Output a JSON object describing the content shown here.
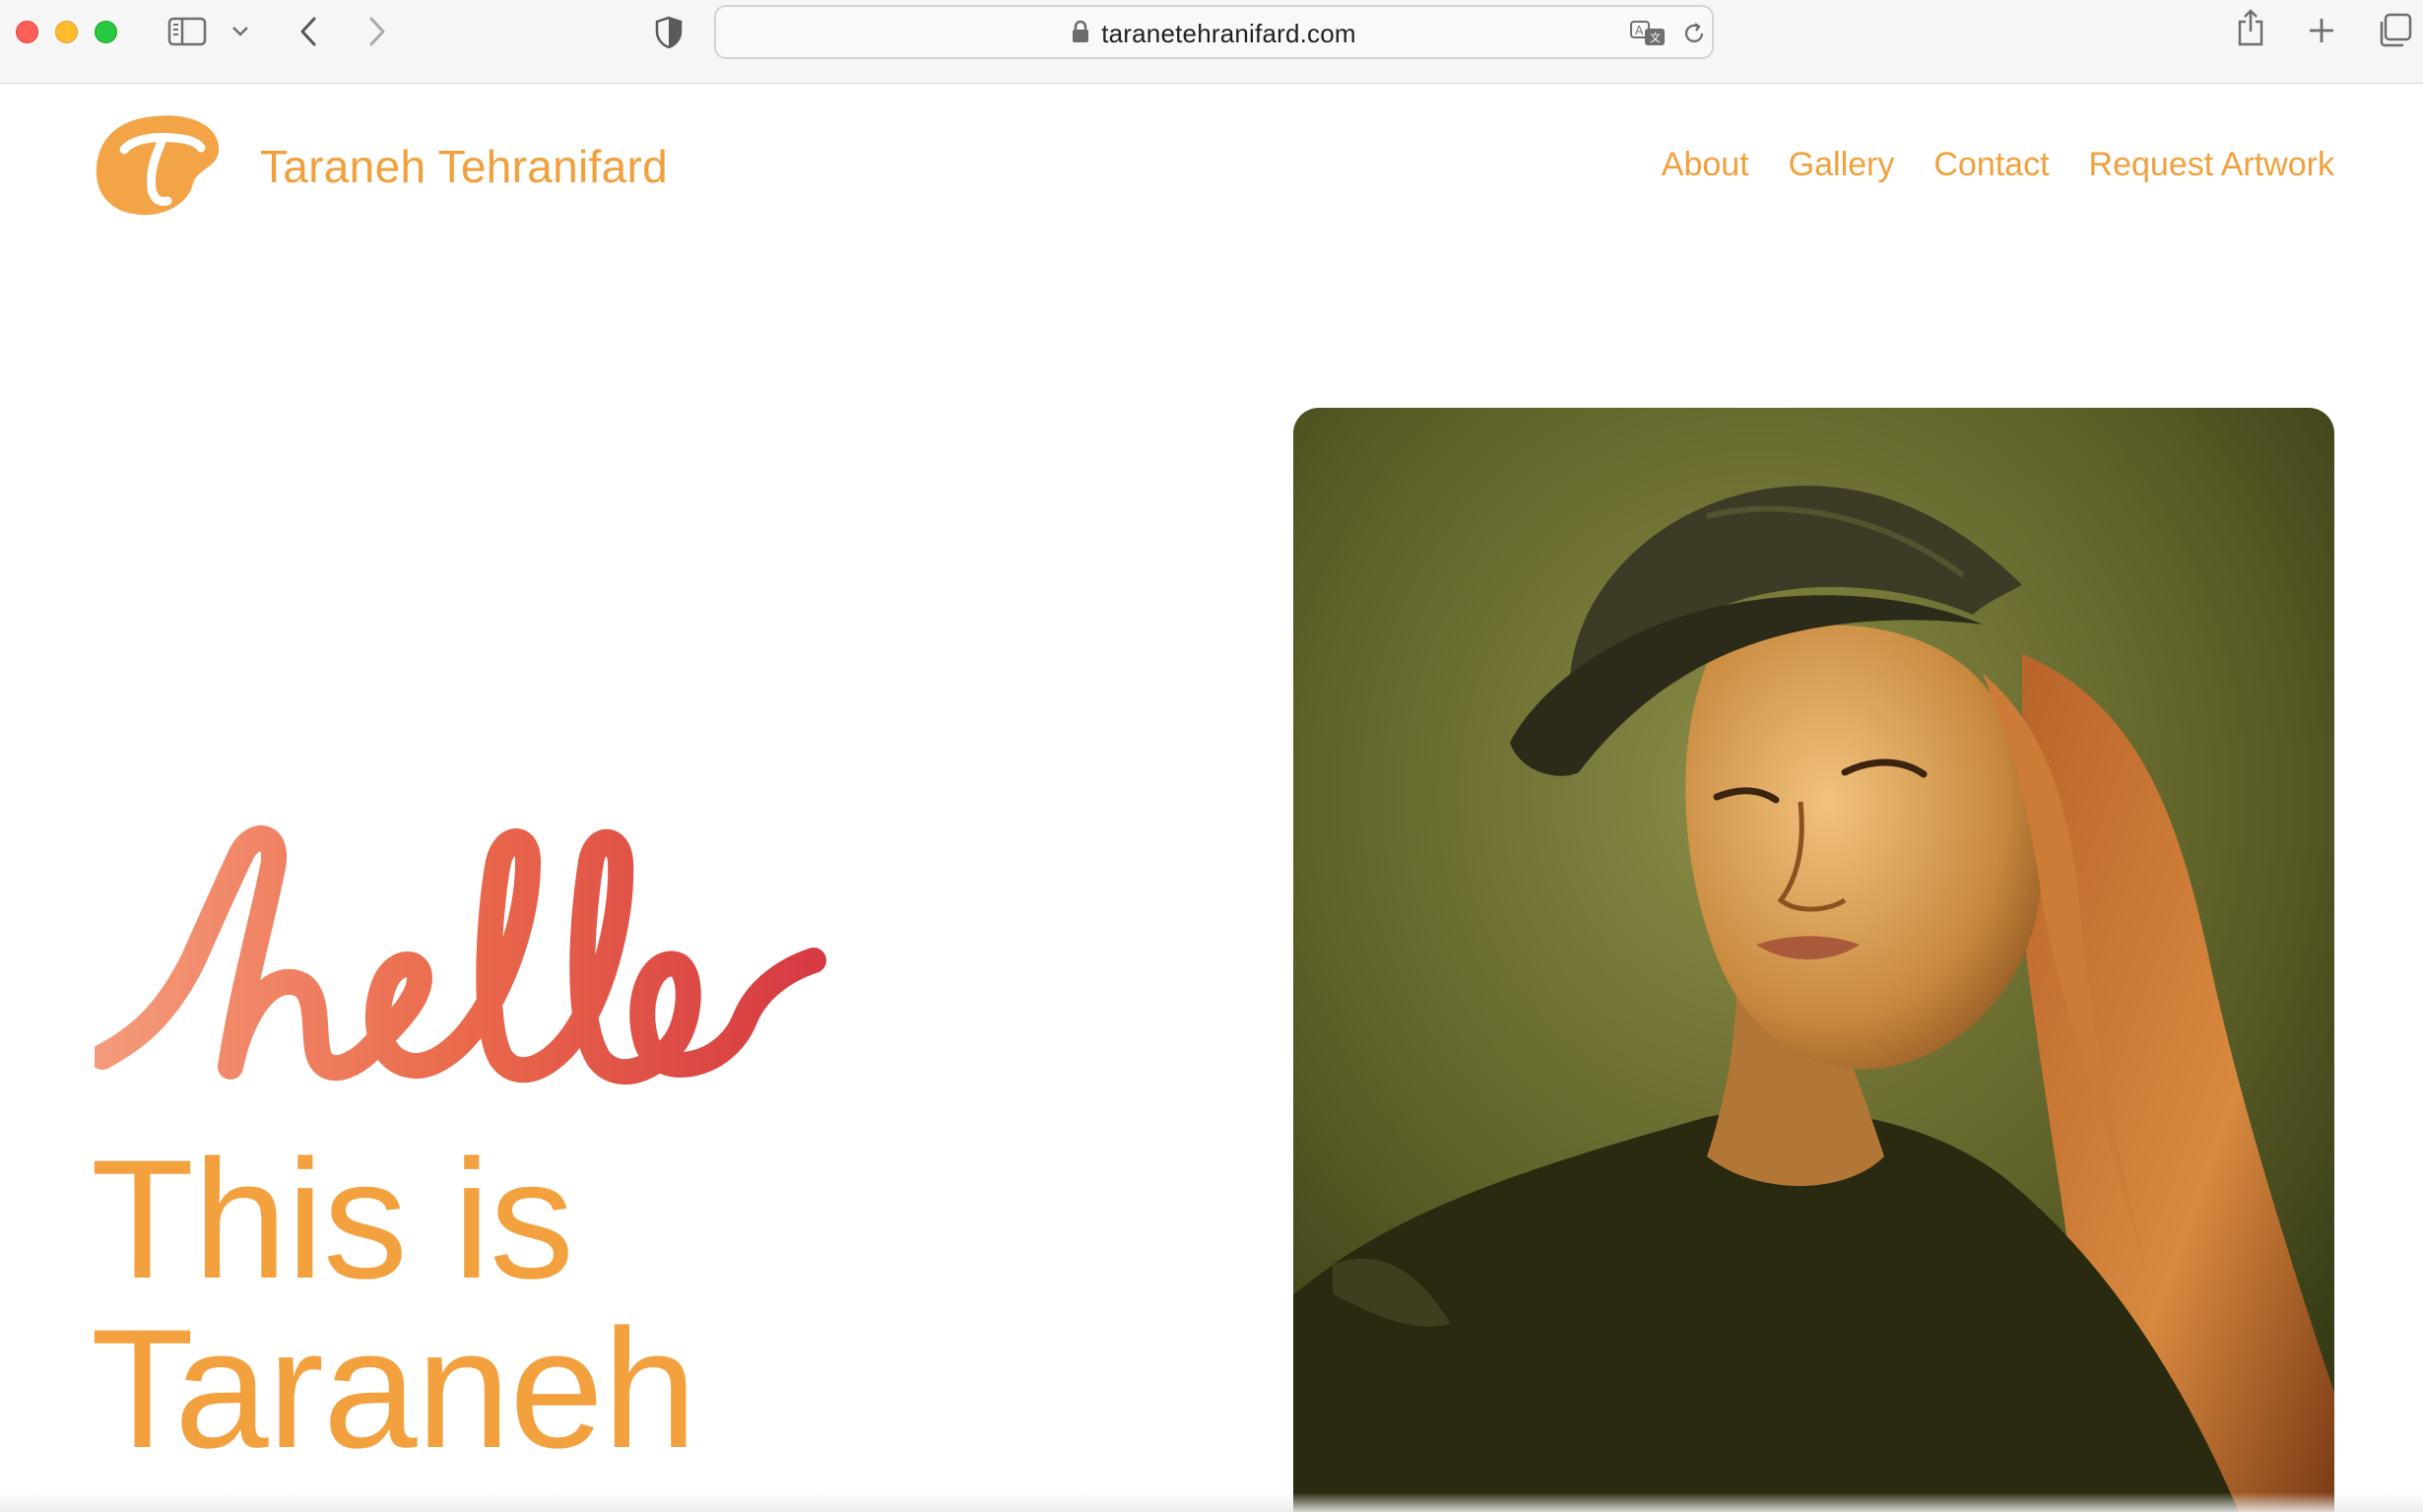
{
  "browser": {
    "url": "taranetehranifard.com",
    "icons": {
      "sidebar": "sidebar-icon",
      "chevron": "chevron-down-icon",
      "back": "back-arrow-icon",
      "forward": "forward-arrow-icon",
      "shield": "privacy-shield-icon",
      "lock": "lock-icon",
      "translate": "translate-icon",
      "reload": "reload-icon",
      "share": "share-icon",
      "new_tab": "plus-icon",
      "tabs": "tab-overview-icon"
    }
  },
  "site": {
    "name": "Taraneh Tehranifard",
    "logo_letter": "T",
    "nav": [
      "About",
      "Gallery",
      "Contact",
      "Request Artwork"
    ],
    "hero": {
      "script_word": "hello",
      "line1": "This is",
      "line2": "Taraneh"
    },
    "colors": {
      "accent": "#f0a03c",
      "hello_start": "#f49a7a",
      "hello_end": "#d63a42"
    }
  }
}
